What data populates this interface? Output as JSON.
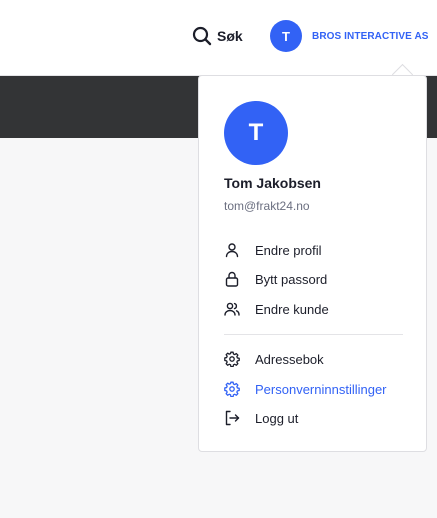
{
  "header": {
    "search_label": "Søk",
    "account": {
      "avatar_initial": "T",
      "company_name": "BROS INTERACTIVE AS"
    }
  },
  "user_menu": {
    "avatar_initial": "T",
    "name": "Tom Jakobsen",
    "email": "tom@frakt24.no",
    "items": [
      {
        "label": "Endre profil",
        "icon": "user-icon"
      },
      {
        "label": "Bytt passord",
        "icon": "lock-icon"
      },
      {
        "label": "Endre kunde",
        "icon": "users-icon"
      },
      {
        "label": "Adressebok",
        "icon": "gear-icon"
      },
      {
        "label": "Personverninnstillinger",
        "icon": "gear-icon",
        "active": true
      },
      {
        "label": "Logg ut",
        "icon": "logout-icon"
      }
    ]
  },
  "colors": {
    "accent": "#3262f5",
    "dark_band": "#333436",
    "text": "#1c1e2a",
    "muted": "#6b6f80"
  }
}
